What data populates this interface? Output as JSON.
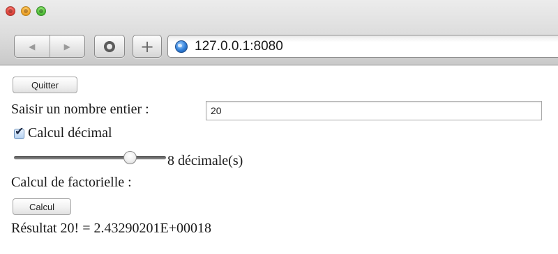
{
  "browser": {
    "url": "127.0.0.1:8080",
    "nav_back_glyph": "◀",
    "nav_forward_glyph": "▶",
    "new_tab_glyph": "+"
  },
  "page": {
    "quit_label": "Quitter",
    "input_label": "Saisir un nombre entier :",
    "input_value": "20",
    "decimal_checkbox_label": "Calcul décimal",
    "decimal_checked": true,
    "slider_fraction": 0.76,
    "decimals_label": "8 décimale(s)",
    "factorial_label": "Calcul de factorielle :",
    "calc_label": "Calcul",
    "result_text": "Résultat 20! = 2.43290201E+00018"
  },
  "colors": {
    "close": "#e0443b",
    "minimize": "#f0a52b",
    "maximize": "#52c03a",
    "globe": "#2f7ed8"
  }
}
